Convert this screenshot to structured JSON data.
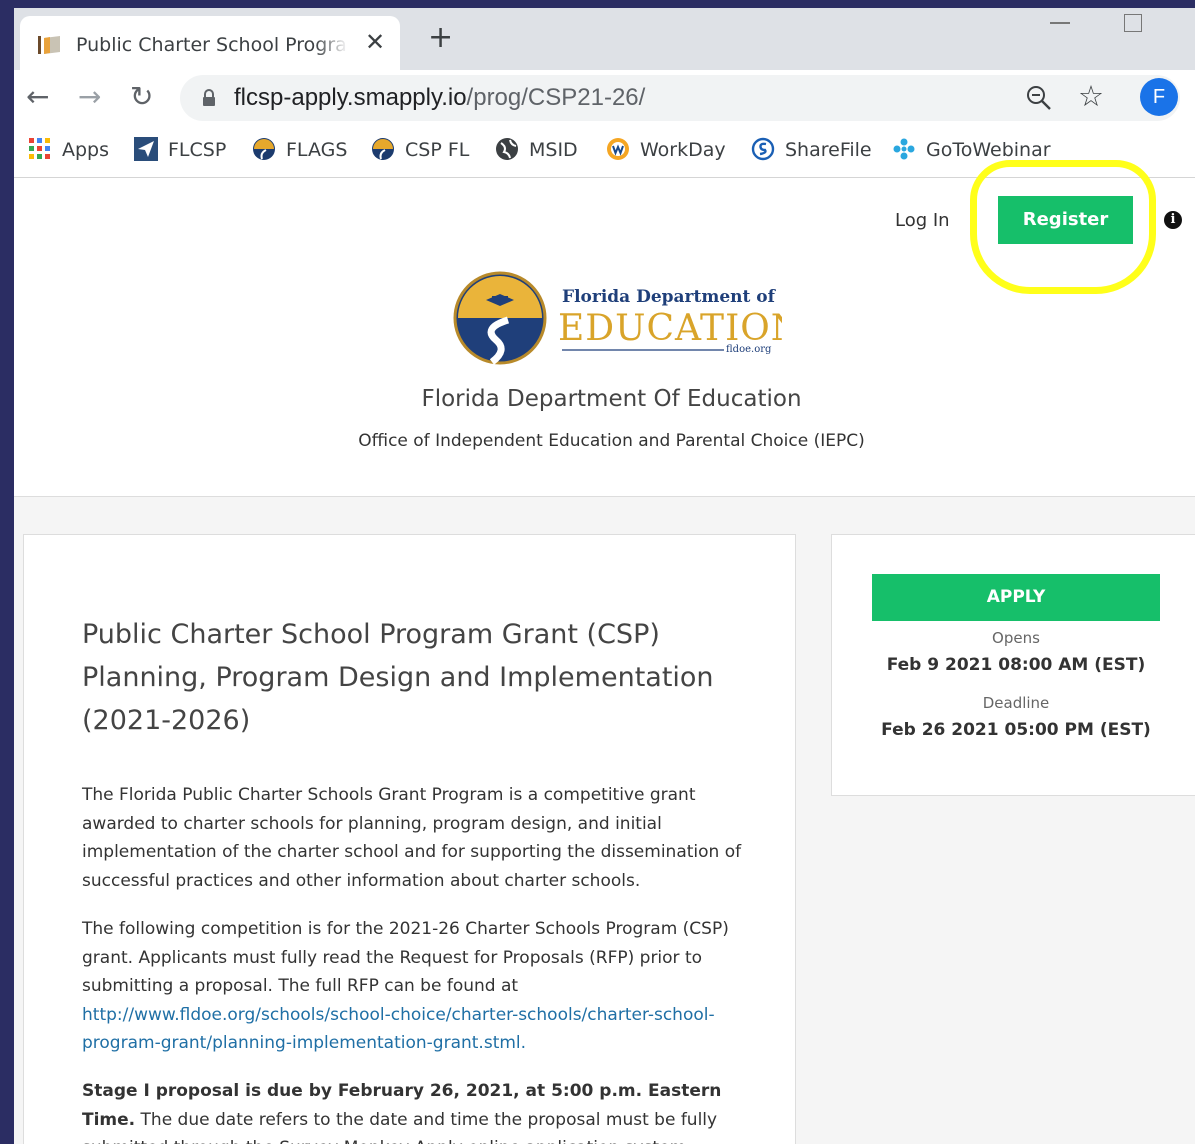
{
  "browser": {
    "tab_title": "Public Charter School Program G",
    "new_tab_symbol": "+",
    "close_symbol": "✕",
    "url_host": "flcsp-apply.smapply.io",
    "url_path": "/prog/CSP21-26/",
    "profile_initial": "F",
    "bookmarks": [
      {
        "label": "Apps",
        "icon": "apps-grid-icon"
      },
      {
        "label": "FLCSP",
        "icon": "paper-plane-icon"
      },
      {
        "label": "FLAGS",
        "icon": "fldoe-icon"
      },
      {
        "label": "CSP FL",
        "icon": "fldoe-icon"
      },
      {
        "label": "MSID",
        "icon": "globe-icon"
      },
      {
        "label": "WorkDay",
        "icon": "workday-icon"
      },
      {
        "label": "ShareFile",
        "icon": "sharefile-icon"
      },
      {
        "label": "GoToWebinar",
        "icon": "gotowebinar-icon"
      }
    ]
  },
  "header": {
    "login_label": "Log In",
    "register_label": "Register",
    "logo_line1": "Florida Department of",
    "logo_line2": "EDUCATION",
    "logo_url": "fldoe.org",
    "org_name": "Florida Department Of Education",
    "office": "Office of Independent Education and Parental Choice (IEPC)"
  },
  "program": {
    "title": "Public Charter School Program Grant (CSP) Planning, Program Design and Implementation (2021-2026)",
    "para1": "The Florida Public Charter Schools Grant Program is a competitive grant awarded to charter schools for planning, program design, and initial implementation of the charter school and for supporting the dissemination of successful practices and other information about charter schools.",
    "para2": "The following competition is for the 2021-26 Charter Schools Program (CSP) grant.  Applicants must fully read the Request for Proposals (RFP) prior to submitting a proposal.  The full RFP can be found at",
    "para2_link": "http://www.fldoe.org/schools/school-choice/charter-schools/charter-school-program-grant/planning-implementation-grant.stml.",
    "para3_bold": "Stage I proposal is due by February 26, 2021, at 5:00 p.m. Eastern Time.",
    "para3": "The due date refers to the date and time the proposal must be fully submitted through the Survey Monkey Apply online application system."
  },
  "sidebar": {
    "apply_label": "APPLY",
    "opens_label": "Opens",
    "opens_value": "Feb 9 2021 08:00 AM (EST)",
    "deadline_label": "Deadline",
    "deadline_value": "Feb 26 2021 05:00 PM (EST)"
  },
  "colors": {
    "accent_green": "#16bf6a",
    "highlight_yellow": "#ffff1a",
    "link_blue": "#1f6fa5"
  }
}
